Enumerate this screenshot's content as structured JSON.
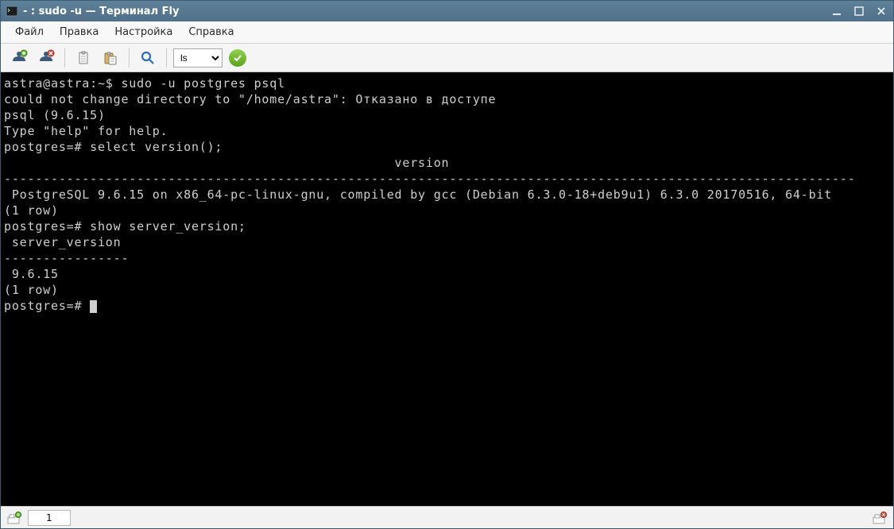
{
  "titlebar": {
    "title": "- : sudo -u — Терминал Fly"
  },
  "menu": {
    "file": "Файл",
    "edit": "Правка",
    "settings": "Настройка",
    "help": "Справка"
  },
  "toolbar": {
    "select_value": "ls",
    "select_options": [
      "ls"
    ]
  },
  "terminal": {
    "lines": [
      "astra@astra:~$ sudo -u postgres psql",
      "could not change directory to \"/home/astra\": Отказано в доступе",
      "psql (9.6.15)",
      "Type \"help\" for help.",
      "",
      "postgres=# select version();",
      "                                                  version",
      "-------------------------------------------------------------------------------------------------------------",
      " PostgreSQL 9.6.15 on x86_64-pc-linux-gnu, compiled by gcc (Debian 6.3.0-18+deb9u1) 6.3.0 20170516, 64-bit",
      "(1 row)",
      "",
      "postgres=# show server_version;",
      " server_version",
      "----------------",
      " 9.6.15",
      "(1 row)",
      "",
      "postgres=# "
    ]
  },
  "statusbar": {
    "tab_label": "1"
  },
  "colors": {
    "titlebar_bg": "#527489",
    "terminal_bg": "#000000",
    "terminal_fg": "#cfcfcf"
  }
}
